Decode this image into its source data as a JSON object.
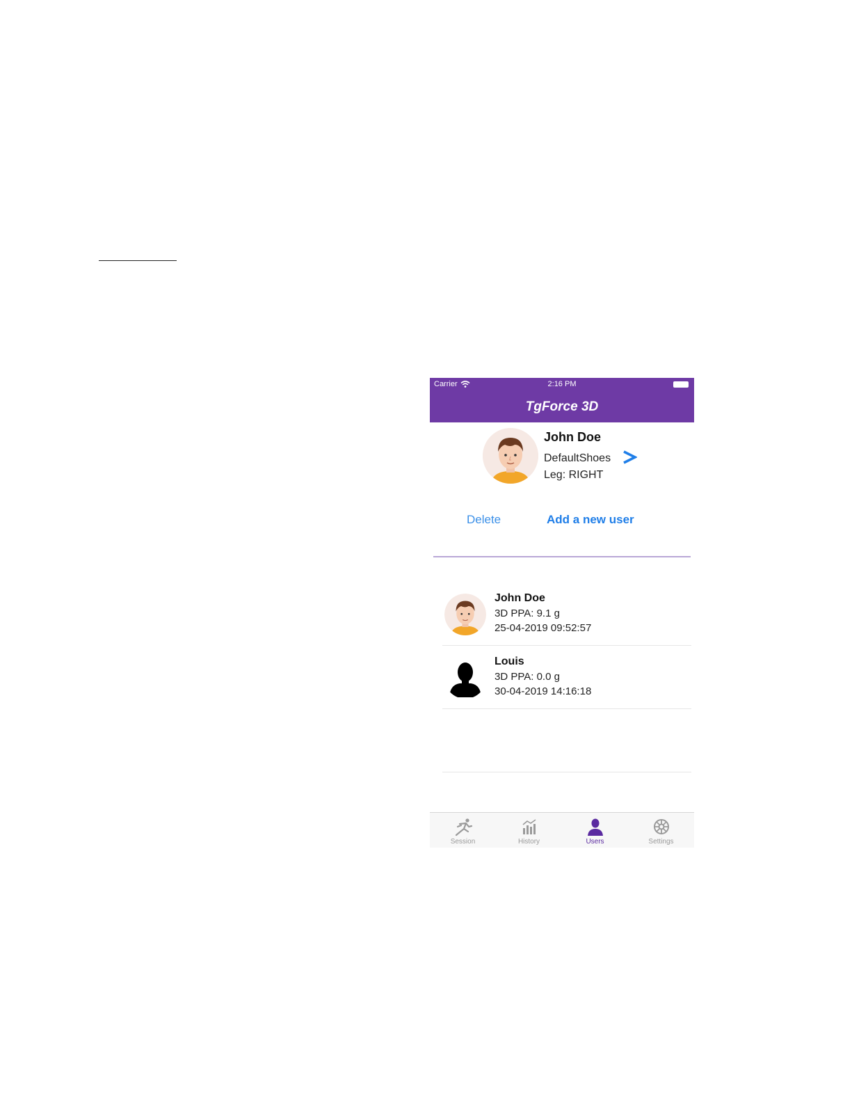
{
  "status_bar": {
    "carrier": "Carrier",
    "time": "2:16 PM"
  },
  "nav": {
    "title": "TgForce 3D"
  },
  "current_user": {
    "name": "John Doe",
    "shoes": "DefaultShoes",
    "chevron": ">",
    "leg": "Leg: RIGHT"
  },
  "actions": {
    "delete_label": "Delete",
    "add_label": "Add a new user"
  },
  "users": [
    {
      "name": "John Doe",
      "ppa": "3D PPA: 9.1 g",
      "date": "25-04-2019  09:52:57",
      "avatar": "face-avatar"
    },
    {
      "name": "Louis",
      "ppa": "3D PPA: 0.0 g",
      "date": "30-04-2019  14:16:18",
      "avatar": "silhouette-avatar"
    }
  ],
  "tabs": [
    {
      "label": "Session",
      "icon": "runner-icon"
    },
    {
      "label": "History",
      "icon": "bar-chart-icon"
    },
    {
      "label": "Users",
      "icon": "user-icon",
      "active": true
    },
    {
      "label": "Settings",
      "icon": "gear-icon"
    }
  ],
  "colors": {
    "brand_purple": "#6e3aa5",
    "link_blue": "#1f7ee8",
    "active_tab": "#5a2aa0",
    "divider": "#b9a7d6"
  }
}
